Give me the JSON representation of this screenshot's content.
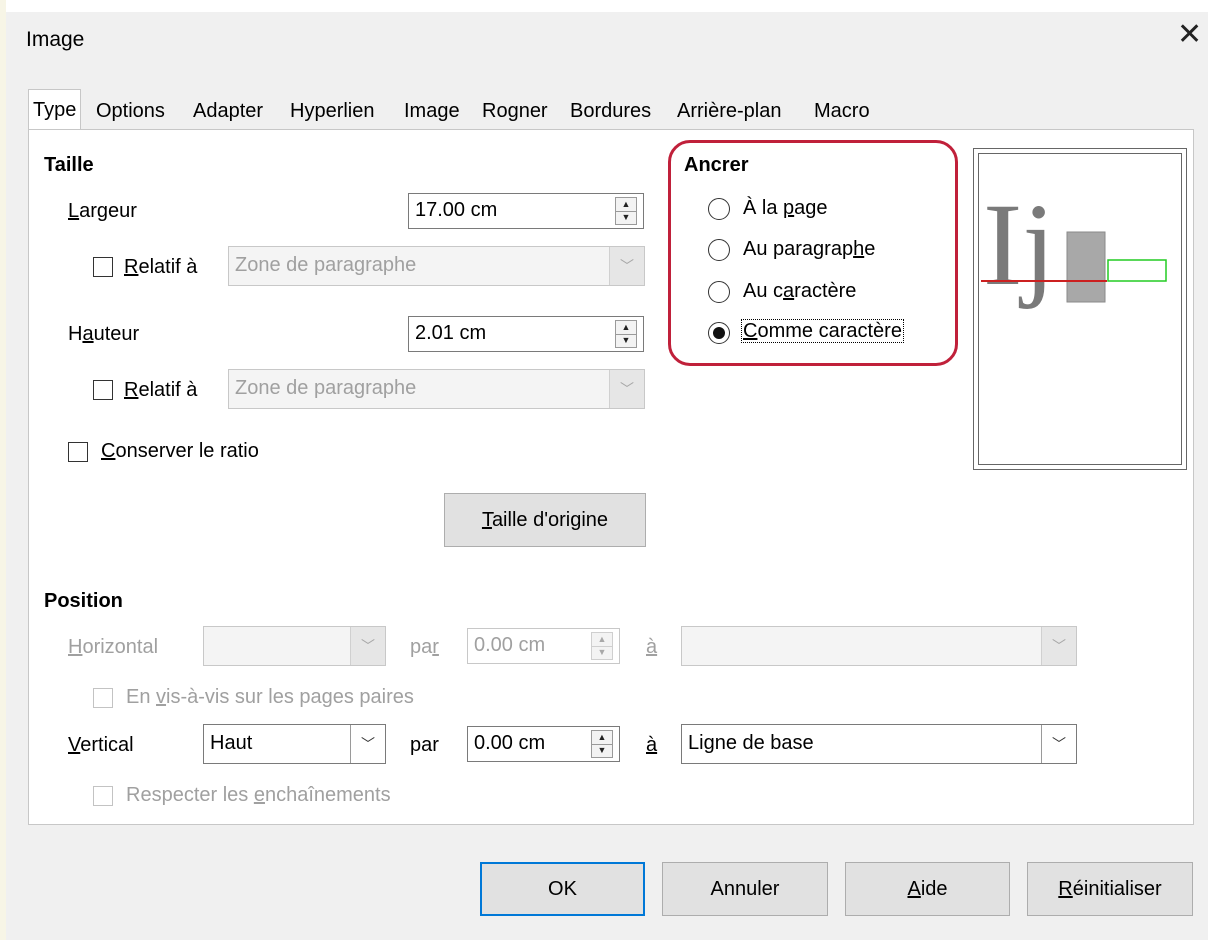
{
  "window": {
    "title": "Image"
  },
  "tabs": [
    {
      "label": "Type"
    },
    {
      "label": "Options"
    },
    {
      "label": "Adapter"
    },
    {
      "label": "Hyperlien"
    },
    {
      "label": "Image"
    },
    {
      "label": "Rogner"
    },
    {
      "label": "Bordures"
    },
    {
      "label": "Arrière-plan"
    },
    {
      "label": "Macro"
    }
  ],
  "taille": {
    "heading": "Taille",
    "largeur": {
      "label_u": "L",
      "label_rest": "argeur",
      "value": "17.00 cm"
    },
    "largeur_rel": {
      "label_u": "R",
      "label_rest": "elatif à",
      "combo": "Zone de paragraphe"
    },
    "hauteur": {
      "label_pre": "H",
      "label_u": "a",
      "label_rest": "uteur",
      "value": "2.01 cm"
    },
    "hauteur_rel": {
      "label_u": "R",
      "label_rest": "elatif à",
      "combo": "Zone de paragraphe"
    },
    "ratio": {
      "label_u": "C",
      "label_rest": "onserver le ratio"
    },
    "original_button": {
      "label_u": "T",
      "label_rest": "aille d'origine"
    }
  },
  "ancrer": {
    "heading": "Ancrer",
    "options": [
      {
        "pre": "À la ",
        "u": "p",
        "rest": "age",
        "checked": false
      },
      {
        "pre": "Au paragrap",
        "u": "h",
        "rest": "e",
        "checked": false
      },
      {
        "pre": "Au c",
        "u": "a",
        "rest": "ractère",
        "checked": false
      },
      {
        "pre": "",
        "u": "C",
        "rest": "omme caractère",
        "checked": true
      }
    ]
  },
  "preview": {
    "glyph_text": "Ij"
  },
  "position": {
    "heading": "Position",
    "horizontal": {
      "label_u": "H",
      "label_rest": "orizontal",
      "combo": "",
      "par_pre": "pa",
      "par_u": "r",
      "value": "0.00 cm",
      "a_label": "à",
      "target": ""
    },
    "mirror": {
      "pre": "En ",
      "u": "v",
      "rest": "is-à-vis sur les pages paires"
    },
    "vertical": {
      "label_u": "V",
      "label_rest": "ertical",
      "combo": "Haut",
      "par": "par",
      "value": "0.00 cm",
      "a_label": "à",
      "target": "Ligne de base"
    },
    "follow": {
      "pre": "Respecter les ",
      "u": "e",
      "rest": "nchaînements"
    }
  },
  "buttons": {
    "ok": "OK",
    "cancel": "Annuler",
    "help_u": "A",
    "help_rest": "ide",
    "reset_u": "R",
    "reset_rest": "éinitialiser"
  },
  "colors": {
    "highlight": "#c0203a",
    "default_button_border": "#0078d7",
    "preview_red": "#cc2020",
    "preview_green": "#22cc22"
  }
}
